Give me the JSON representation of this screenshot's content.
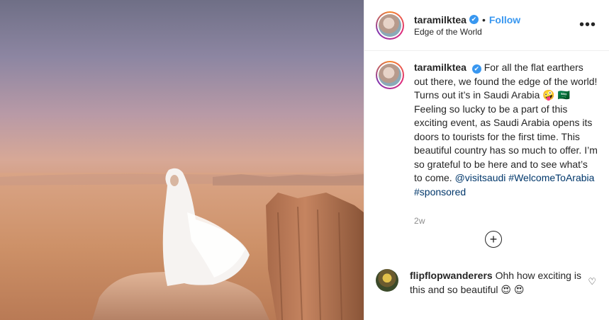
{
  "header": {
    "username": "taramilktea",
    "verified_icon": "✔",
    "separator": "•",
    "follow_label": "Follow",
    "location": "Edge of the World",
    "more_label": "•••"
  },
  "caption": {
    "username": "taramilktea",
    "verified_icon": "✔",
    "text_1": "For all the flat earthers out there, we found the edge of the world! Turns out it’s in Saudi Arabia 🤪 🇸🇦 Feeling so lucky to be a part of this exciting event, as Saudi Arabia opens its doors to tourists for the first time. This beautiful country has so much to offer. I’m so grateful to be here and to see what’s to come.",
    "mention": "@visitsaudi",
    "hashtag_1": "#WelcomeToArabia",
    "hashtag_2": "#sponsored",
    "time_ago": "2w"
  },
  "load_more": {
    "label": "+"
  },
  "comment": {
    "username": "flipflopwanderers",
    "text": "Ohh how exciting is this and so beautiful 😍 😍",
    "like_icon": "♡"
  },
  "colors": {
    "accent": "#3897f0",
    "link": "#00376b",
    "muted": "#8e8e8e",
    "text": "#262626"
  }
}
